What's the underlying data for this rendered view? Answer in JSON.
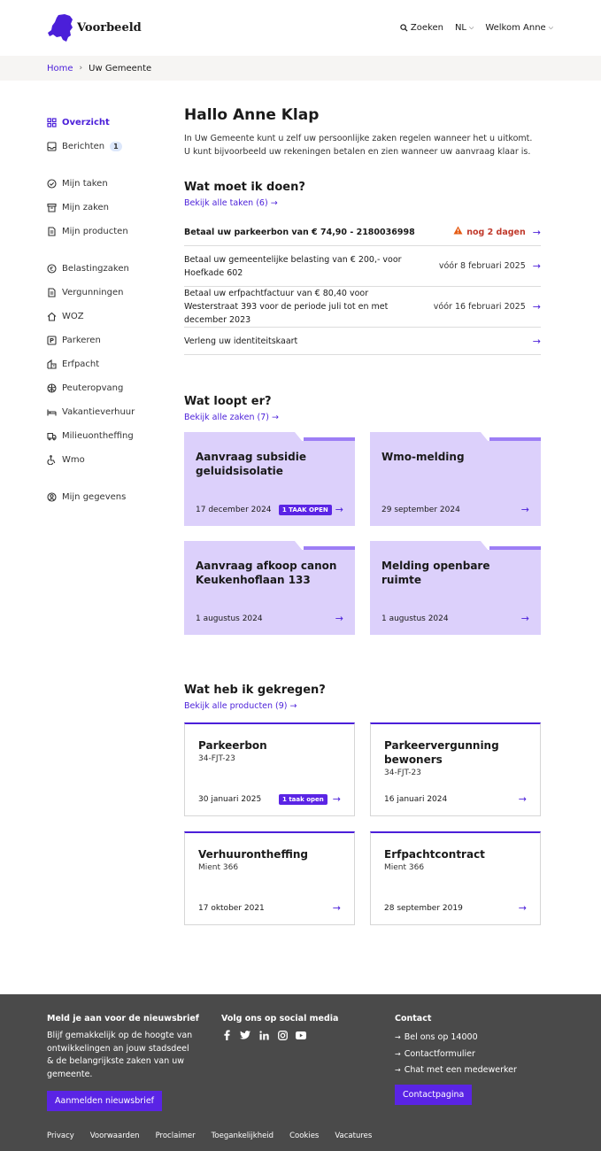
{
  "brand": {
    "name": "Voorbeeld",
    "accent": "#4b1fd9"
  },
  "header": {
    "search": "Zoeken",
    "language": "NL",
    "welcome": "Welkom Anne"
  },
  "breadcrumb": {
    "home": "Home",
    "current": "Uw Gemeente"
  },
  "sidebar": {
    "overview": "Overzicht",
    "messages": "Berichten",
    "messages_count": "1",
    "group1": [
      "Mijn taken",
      "Mijn zaken",
      "Mijn producten"
    ],
    "group2": [
      "Belastingzaken",
      "Vergunningen",
      "WOZ",
      "Parkeren",
      "Erfpacht",
      "Peuteropvang",
      "Vakantieverhuur",
      "Milieuontheffing",
      "Wmo"
    ],
    "profile": "Mijn gegevens"
  },
  "main": {
    "title": "Hallo Anne Klap",
    "intro": "In Uw Gemeente kunt u zelf uw persoonlijke zaken regelen wanneer het u uitkomt. U kunt bijvoorbeeld uw rekeningen betalen en zien wanneer uw aanvraag klaar is."
  },
  "tasks": {
    "heading": "Wat moet ik doen?",
    "link": "Bekijk alle taken (6)",
    "items": [
      {
        "text": "Betaal uw parkeerbon van € 74,90 - 2180036998",
        "deadline": "nog 2 dagen"
      },
      {
        "text": "Betaal uw gemeentelijke belasting van € 200,- voor Hoefkade 602",
        "deadline": "vóór 8 februari 2025"
      },
      {
        "text": "Betaal uw erfpachtfactuur van € 80,40 voor Westerstraat 393 voor de periode juli tot en met december 2023",
        "deadline": "vóór 16 februari 2025"
      },
      {
        "text": "Verleng uw identiteitskaart",
        "deadline": ""
      }
    ]
  },
  "cases": {
    "heading": "Wat loopt er?",
    "link": "Bekijk alle zaken (7)",
    "items": [
      {
        "title": "Aanvraag subsidie geluidsisolatie",
        "date": "17 december 2024",
        "badge": "1 TAAK OPEN"
      },
      {
        "title": "Wmo-melding",
        "date": "29 september 2024",
        "badge": ""
      },
      {
        "title": "Aanvraag afkoop canon Keukenhoflaan 133",
        "date": "1 augustus 2024",
        "badge": ""
      },
      {
        "title": "Melding openbare ruimte",
        "date": "1 augustus 2024",
        "badge": ""
      }
    ]
  },
  "products": {
    "heading": "Wat heb ik gekregen?",
    "link": "Bekijk alle producten (9)",
    "items": [
      {
        "title": "Parkeerbon",
        "sub": "34-FJT-23",
        "date": "30 januari 2025",
        "badge": "1 taak open"
      },
      {
        "title": "Parkeervergunning bewoners",
        "sub": "34-FJT-23",
        "date": "16 januari 2024",
        "badge": ""
      },
      {
        "title": "Verhuurontheffing",
        "sub": "Mient 366",
        "date": "17 oktober 2021",
        "badge": ""
      },
      {
        "title": "Erfpachtcontract",
        "sub": "Mient 366",
        "date": "28 september 2019",
        "badge": ""
      }
    ]
  },
  "footer": {
    "newsletter_heading": "Meld je aan voor de nieuwsbrief",
    "newsletter_text": "Blijf gemakkelijk op de hoogte van ontwikkelingen an jouw stadsdeel & de belangrijkste zaken van uw gemeente.",
    "newsletter_button": "Aanmelden nieuwsbrief",
    "social_heading": "Volg ons op social media",
    "contact_heading": "Contact",
    "contact_links": [
      "Bel ons op 14000",
      "Contactformulier",
      "Chat met een medewerker"
    ],
    "contact_button": "Contactpagina",
    "bottom_links": [
      "Privacy",
      "Voorwaarden",
      "Proclaimer",
      "Toegankelijkheid",
      "Cookies",
      "Vacatures"
    ]
  }
}
